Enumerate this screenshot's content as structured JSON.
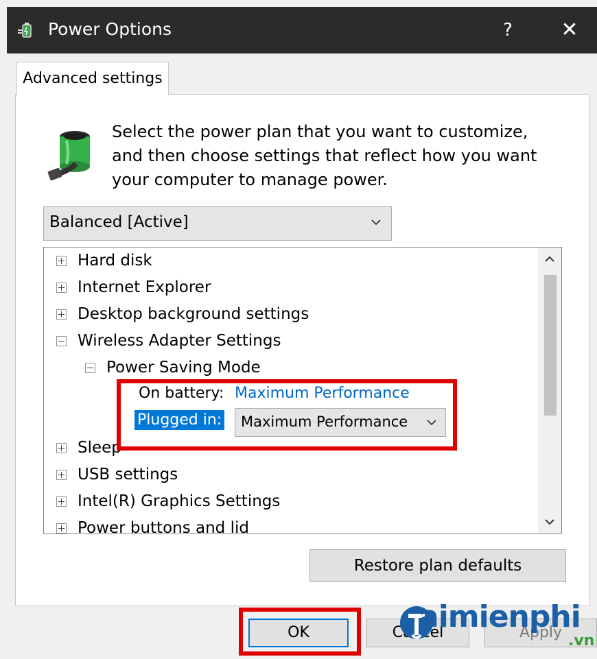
{
  "window": {
    "title": "Power Options",
    "help_label": "?",
    "close_label": "✕"
  },
  "tab": {
    "label": "Advanced settings"
  },
  "description": "Select the power plan that you want to customize, and then choose settings that reflect how you want your computer to manage power.",
  "plan_select": {
    "value": "Balanced [Active]"
  },
  "tree": {
    "items": [
      {
        "label": "Hard disk",
        "toggle": "plus"
      },
      {
        "label": "Internet Explorer",
        "toggle": "plus"
      },
      {
        "label": "Desktop background settings",
        "toggle": "plus"
      },
      {
        "label": "Wireless Adapter Settings",
        "toggle": "minus"
      },
      {
        "label": "Power Saving Mode",
        "toggle": "minus"
      },
      {
        "label": "Sleep",
        "toggle": "plus"
      },
      {
        "label": "USB settings",
        "toggle": "plus"
      },
      {
        "label": "Intel(R) Graphics Settings",
        "toggle": "plus"
      },
      {
        "label": "Power buttons and lid",
        "toggle": "plus"
      }
    ],
    "on_battery_label": "On battery:",
    "on_battery_value": "Maximum Performance",
    "plugged_in_label": "Plugged in:",
    "plugged_in_value": "Maximum Performance"
  },
  "buttons": {
    "restore": "Restore plan defaults",
    "ok": "OK",
    "cancel": "Cancel",
    "apply": "Apply"
  },
  "watermark": {
    "brand": "aimienphi",
    "domain": ".vn"
  },
  "colors": {
    "highlight": "#e00000",
    "selection": "#0078d7",
    "link": "#0066cc",
    "titlebar": "#2b2b2b"
  },
  "icons": [
    "power-options-icon",
    "battery-plug-icon",
    "chevron-down-icon",
    "scroll-up-icon",
    "scroll-down-icon"
  ]
}
